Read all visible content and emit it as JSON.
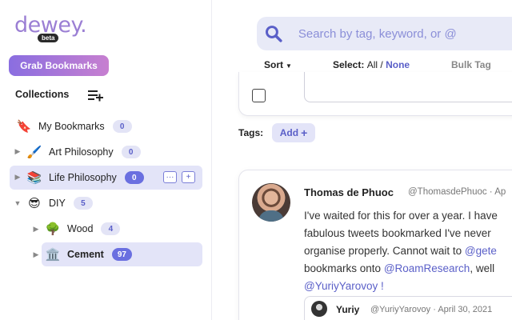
{
  "app": {
    "logo_text": "dewey.",
    "beta_label": "beta",
    "grab_button": "Grab Bookmarks"
  },
  "sidebar": {
    "collections_title": "Collections",
    "items": [
      {
        "emoji": "🔖",
        "label": "My Bookmarks",
        "count": "0"
      },
      {
        "emoji": "🖌️",
        "label": "Art Philosophy",
        "count": "0"
      },
      {
        "emoji": "📚",
        "label": "Life Philosophy",
        "count": "0"
      },
      {
        "emoji": "😎",
        "label": "DIY",
        "count": "5"
      },
      {
        "emoji": "🌳",
        "label": "Wood",
        "count": "4"
      },
      {
        "emoji": "🏛️",
        "label": "Cement",
        "count": "97"
      }
    ]
  },
  "search": {
    "placeholder": "Search by tag, keyword, or @"
  },
  "toolbar": {
    "sort": "Sort",
    "select_label": "Select:",
    "select_all": "All",
    "separator": "/",
    "select_none": "None",
    "bulk_tag": "Bulk Tag"
  },
  "tags": {
    "label": "Tags:",
    "add": "Add"
  },
  "tweet": {
    "author": "Thomas de Phuoc",
    "handle": "@ThomasdePhuoc · Ap",
    "lines": [
      "I've waited for this for over a year. I have",
      "fabulous tweets bookmarked I've never",
      "organise properly. Cannot wait to ",
      "bookmarks onto ",
      "@YuriyYarovoy !"
    ],
    "mention_getdewey": "@gete",
    "mention_roam": "@RoamResearch",
    "line4_tail": ", well",
    "quote": {
      "name": "Yuriy",
      "handle": "@YuriyYarovoy · April 30, 2021"
    }
  },
  "colors": {
    "accent": "#5a5fc8",
    "selected_bg": "#e3e4f8",
    "gradient_start": "#8a6ee0",
    "gradient_end": "#c77fd0"
  }
}
